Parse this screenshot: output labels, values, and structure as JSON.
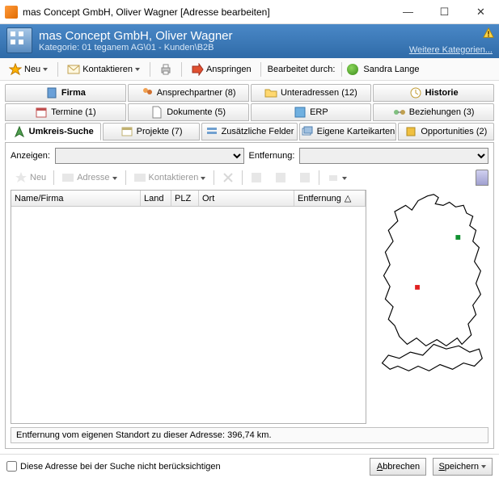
{
  "window": {
    "title": "mas Concept GmbH, Oliver Wagner [Adresse bearbeiten]"
  },
  "header": {
    "title": "mas Concept GmbH, Oliver Wagner",
    "category_label": "Kategorie:",
    "category_value": "01 teganem AG\\01 - Kunden\\B2B",
    "more_link": "Weitere Kategorien..."
  },
  "toolbar": {
    "neu": "Neu",
    "kontaktieren": "Kontaktieren",
    "anspringen": "Anspringen",
    "bearbeitet_label": "Bearbeitet durch:",
    "user": "Sandra Lange"
  },
  "tabs_row1": [
    {
      "label": "Firma",
      "icon": "company-icon"
    },
    {
      "label": "Ansprechpartner (8)",
      "icon": "contacts-icon"
    },
    {
      "label": "Unteradressen (12)",
      "icon": "folder-icon"
    },
    {
      "label": "Historie",
      "icon": "clock-icon"
    }
  ],
  "tabs_row2": [
    {
      "label": "Termine (1)",
      "icon": "calendar-icon"
    },
    {
      "label": "Dokumente (5)",
      "icon": "document-icon"
    },
    {
      "label": "ERP",
      "icon": "erp-icon"
    },
    {
      "label": "Beziehungen (3)",
      "icon": "relation-icon"
    }
  ],
  "tabs_row3": [
    {
      "label": "Umkreis-Suche",
      "icon": "radius-icon",
      "active": true
    },
    {
      "label": "Projekte (7)",
      "icon": "projects-icon"
    },
    {
      "label": "Zusätzliche Felder",
      "icon": "fields-icon"
    },
    {
      "label": "Eigene Karteikarten",
      "icon": "cards-icon"
    },
    {
      "label": "Opportunities (2)",
      "icon": "opportunity-icon"
    }
  ],
  "filter": {
    "anzeigen": "Anzeigen:",
    "entfernung": "Entfernung:"
  },
  "subtoolbar": {
    "neu": "Neu",
    "adresse": "Adresse",
    "kontaktieren": "Kontaktieren"
  },
  "table": {
    "cols": [
      "Name/Firma",
      "Land",
      "PLZ",
      "Ort",
      "Entfernung"
    ]
  },
  "status": "Entfernung vom eigenen Standort zu dieser Adresse: 396,74 km.",
  "footer": {
    "checkbox": "Diese Adresse bei der Suche nicht berücksichtigen",
    "cancel": "Abbrechen",
    "save": "Speichern"
  }
}
